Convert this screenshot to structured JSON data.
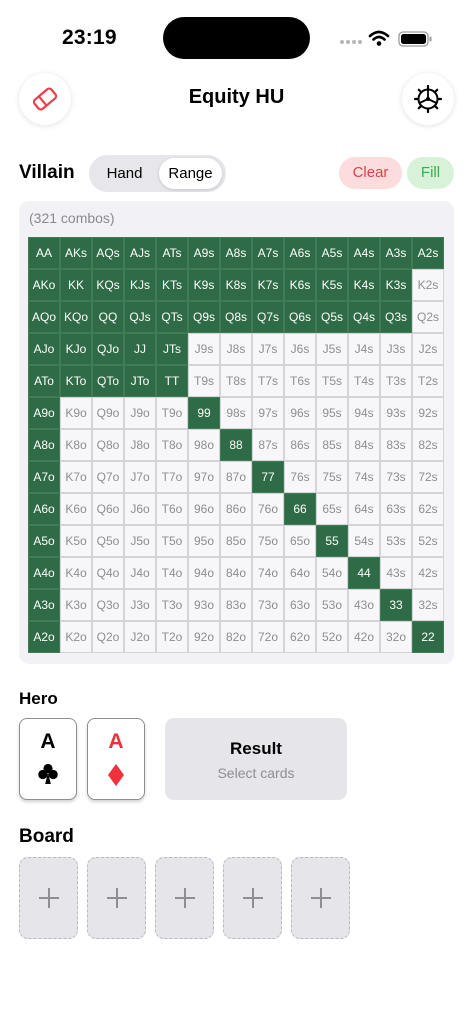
{
  "status": {
    "time": "23:19"
  },
  "header": {
    "title": "Equity HU",
    "eraser_icon": "eraser-icon",
    "settings_icon": "gear-icon"
  },
  "villain": {
    "label": "Villain",
    "tabs": [
      "Hand",
      "Range"
    ],
    "selected_tab": "Range",
    "clear_label": "Clear",
    "fill_label": "Fill",
    "combos_label": "(321 combos)"
  },
  "range_grid": {
    "ranks": [
      "A",
      "K",
      "Q",
      "J",
      "T",
      "9",
      "8",
      "7",
      "6",
      "5",
      "4",
      "3",
      "2"
    ],
    "selected": [
      "AA",
      "AKs",
      "AQs",
      "AJs",
      "ATs",
      "A9s",
      "A8s",
      "A7s",
      "A6s",
      "A5s",
      "A4s",
      "A3s",
      "A2s",
      "AKo",
      "KK",
      "KQs",
      "KJs",
      "KTs",
      "K9s",
      "K8s",
      "K7s",
      "K6s",
      "K5s",
      "K4s",
      "K3s",
      "AQo",
      "KQo",
      "QQ",
      "QJs",
      "QTs",
      "Q9s",
      "Q8s",
      "Q7s",
      "Q6s",
      "Q5s",
      "Q4s",
      "Q3s",
      "AJo",
      "KJo",
      "QJo",
      "JJ",
      "JTs",
      "ATo",
      "KTo",
      "QTo",
      "JTo",
      "TT",
      "A9o",
      "99",
      "A8o",
      "88",
      "A7o",
      "77",
      "A6o",
      "66",
      "A5o",
      "55",
      "A4o",
      "44",
      "A3o",
      "33",
      "A2o",
      "22"
    ],
    "colors": {
      "selected": "#2e6b46",
      "unselected": "#f7f7f9"
    }
  },
  "hero": {
    "label": "Hero",
    "cards": [
      {
        "rank": "A",
        "suit": "clubs",
        "color": "#000000"
      },
      {
        "rank": "A",
        "suit": "diamonds",
        "color": "#f0303a"
      }
    ],
    "result_title": "Result",
    "result_subtitle": "Select cards"
  },
  "board": {
    "label": "Board",
    "slot_icon": "plus-icon",
    "slots": [
      "empty",
      "empty",
      "empty",
      "empty",
      "empty"
    ]
  }
}
